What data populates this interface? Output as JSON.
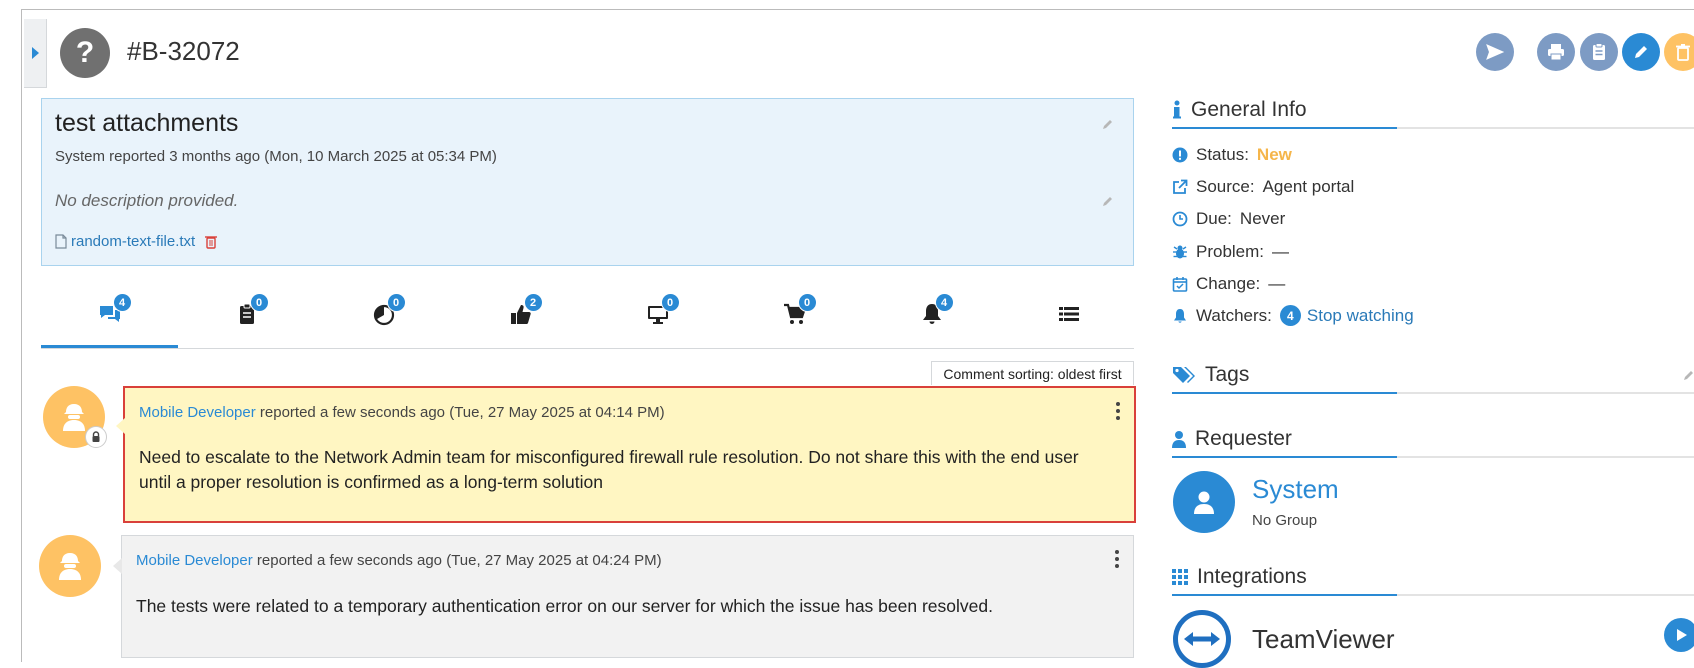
{
  "ticket": {
    "id": "#B-32072",
    "type_symbol": "?"
  },
  "description": {
    "title": "test attachments",
    "meta": "System reported 3 months ago (Mon, 10 March 2025 at 05:34 PM)",
    "text": "No description provided.",
    "attachment": "random-text-file.txt"
  },
  "tabs": [
    {
      "icon": "comments-icon",
      "badge": "4"
    },
    {
      "icon": "clipboard-icon",
      "badge": "0"
    },
    {
      "icon": "time-icon",
      "badge": "0"
    },
    {
      "icon": "thumbs-up-icon",
      "badge": "2"
    },
    {
      "icon": "monitor-icon",
      "badge": "0"
    },
    {
      "icon": "cart-icon",
      "badge": "0"
    },
    {
      "icon": "bell-icon",
      "badge": "4"
    },
    {
      "icon": "list-icon",
      "badge": ""
    }
  ],
  "sorting_label": "Comment sorting: oldest first",
  "comments": [
    {
      "author": "Mobile Developer",
      "meta": "reported a few seconds ago (Tue, 27 May 2025 at 04:14 PM)",
      "body": "Need to escalate to the Network Admin team for misconfigured firewall rule resolution. Do not share this with the end user until a proper resolution is confirmed as a long-term solution"
    },
    {
      "author": "Mobile Developer",
      "meta": "reported a few seconds ago (Tue, 27 May 2025 at 04:24 PM)",
      "body": "The tests were related to a temporary authentication error on our server for which the issue has been resolved."
    }
  ],
  "general_info": {
    "heading": "General Info",
    "status_label": "Status:",
    "status_value": "New",
    "source_label": "Source:",
    "source_value": "Agent portal",
    "due_label": "Due:",
    "due_value": "Never",
    "problem_label": "Problem:",
    "problem_value": "—",
    "change_label": "Change:",
    "change_value": "—",
    "watchers_label": "Watchers:",
    "watchers_count": "4",
    "watchers_link": "Stop watching"
  },
  "tags": {
    "heading": "Tags"
  },
  "requester": {
    "heading": "Requester",
    "name": "System",
    "group": "No Group"
  },
  "integrations": {
    "heading": "Integrations",
    "items": [
      {
        "name": "TeamViewer"
      }
    ]
  },
  "colors": {
    "accent": "#2a8ad4",
    "status_new": "#f5b54a",
    "private_border": "#d9403a",
    "private_bg": "#fff6c2",
    "avatar": "#fec264"
  }
}
